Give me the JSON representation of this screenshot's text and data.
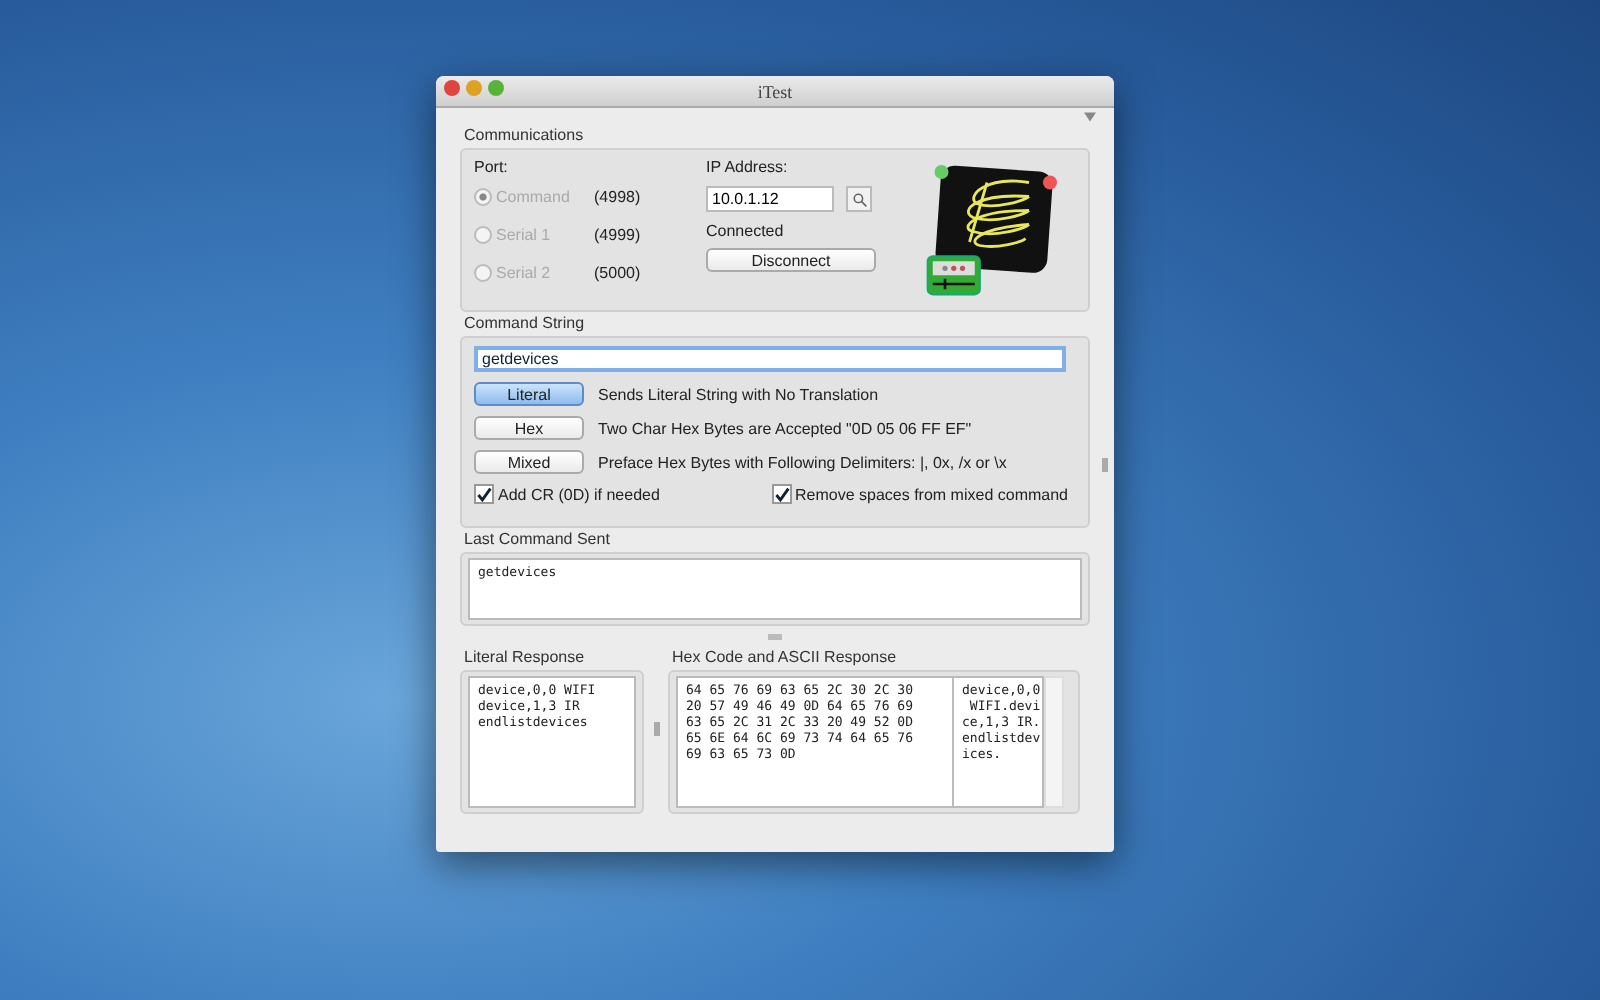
{
  "window": {
    "title": "iTest"
  },
  "communications": {
    "label": "Communications",
    "port_label": "Port:",
    "ports": [
      {
        "label": "Command",
        "number": "(4998)",
        "selected": true,
        "disabled": true
      },
      {
        "label": "Serial 1",
        "number": "(4999)",
        "selected": false,
        "disabled": true
      },
      {
        "label": "Serial 2",
        "number": "(5000)",
        "selected": false,
        "disabled": true
      }
    ],
    "ip_label": "IP Address:",
    "ip_value": "10.0.1.12",
    "status": "Connected",
    "button": "Disconnect"
  },
  "command_string": {
    "label": "Command String",
    "value": "getdevices",
    "modes": [
      {
        "label": "Literal",
        "description": "Sends Literal String with No Translation",
        "selected": true
      },
      {
        "label": "Hex",
        "description": "Two Char Hex Bytes are Accepted \"0D 05 06 FF EF\"",
        "selected": false
      },
      {
        "label": "Mixed",
        "description": "Preface Hex Bytes with Following Delimiters: |, 0x, /x or \\x",
        "selected": false
      }
    ],
    "options": [
      {
        "label": "Add CR (0D) if needed",
        "checked": true
      },
      {
        "label": "Remove spaces from mixed command",
        "checked": true
      }
    ]
  },
  "last_command": {
    "label": "Last Command Sent",
    "text": "getdevices"
  },
  "literal_response": {
    "label": "Literal Response",
    "lines": [
      "device,0,0 WIFI",
      "device,1,3 IR",
      "endlistdevices"
    ]
  },
  "hex_response": {
    "label": "Hex Code and ASCII Response",
    "hex_lines": [
      "64 65 76 69 63 65 2C 30 2C 30",
      "20 57 49 46 49 0D 64 65 76 69",
      "63 65 2C 31 2C 33 20 49 52 0D",
      "65 6E 64 6C 69 73 74 64 65 76",
      "69 63 65 73 0D"
    ],
    "ascii_lines": [
      "device,0,0",
      " WIFI.devi",
      "ce,1,3 IR.",
      "endlistdev",
      "ices."
    ]
  }
}
